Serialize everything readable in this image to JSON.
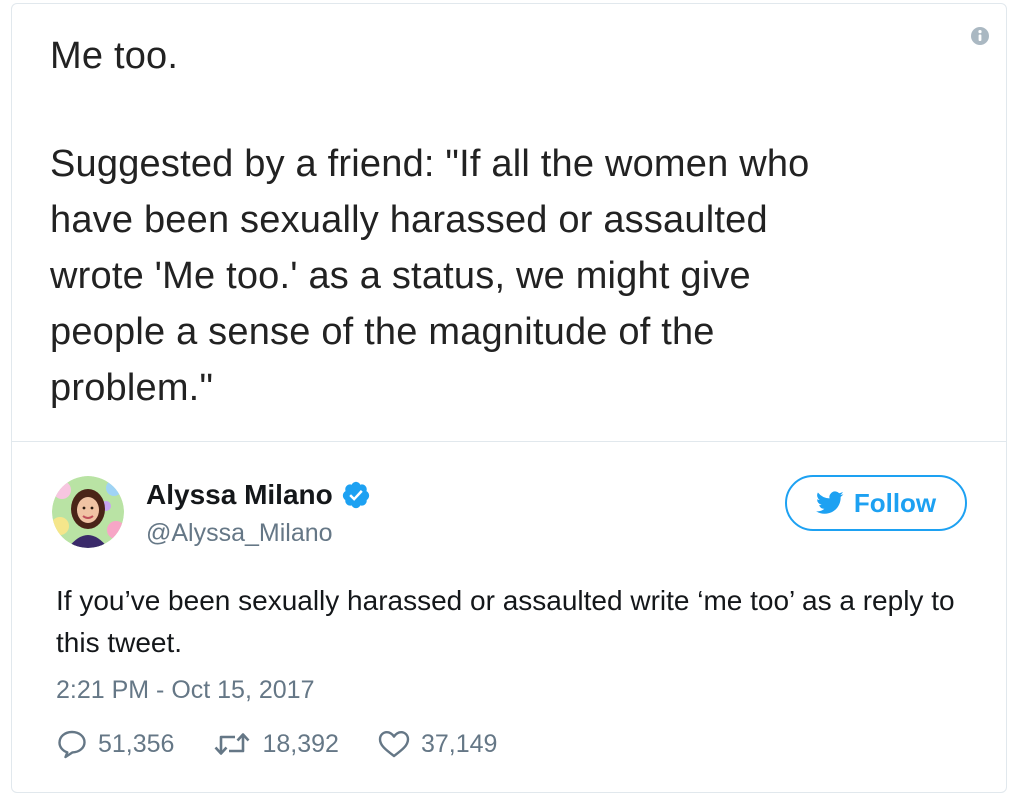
{
  "image_text": {
    "line1": "Me too.",
    "paragraph": "Suggested by a friend: \"If all the women who\nhave been sexually harassed or assaulted\nwrote 'Me too.' as a status, we might give\npeople a sense of the magnitude of the\nproblem.\""
  },
  "tweet": {
    "author_name": "Alyssa Milano",
    "author_handle": "@Alyssa_Milano",
    "follow_label": "Follow",
    "text": "If you’ve been sexually harassed or assaulted write ‘me too’ as a reply to this tweet.",
    "timestamp": "2:21 PM - Oct 15, 2017",
    "stats": {
      "replies": "51,356",
      "retweets": "18,392",
      "likes": "37,149"
    }
  },
  "icons": {
    "info": "info-icon",
    "verified": "verified-badge-icon",
    "follow": "twitter-bird-icon",
    "reply": "reply-bubble-icon",
    "retweet": "retweet-icon",
    "like": "heart-icon"
  },
  "colors": {
    "accent": "#1da1f2",
    "muted": "#657786",
    "text": "#14171a",
    "border": "#e1e8ed"
  }
}
